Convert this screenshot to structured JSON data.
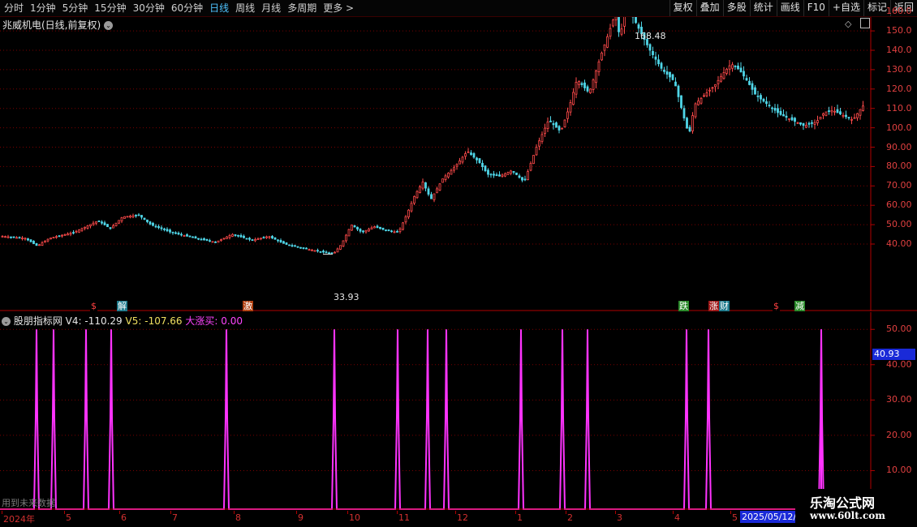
{
  "toolbar": {
    "periods": [
      "分时",
      "1分钟",
      "5分钟",
      "15分钟",
      "30分钟",
      "60分钟",
      "日线",
      "周线",
      "月线",
      "多周期",
      "更多 >"
    ],
    "active_period": "日线",
    "buttons": [
      "复权",
      "叠加",
      "多股",
      "统计",
      "画线",
      "F10",
      "+自选",
      "标记",
      "返回"
    ]
  },
  "main_chart": {
    "title": "兆威机电(日线,前复权)",
    "high_label": "168.48",
    "low_label": "33.93",
    "price_axis": [
      "160.0",
      "150.0",
      "140.0",
      "130.0",
      "120.0",
      "110.0",
      "100.0",
      "90.00",
      "80.00",
      "70.00",
      "60.00",
      "50.00",
      "40.00"
    ],
    "markers": [
      {
        "text": "$",
        "color": "#ff4040",
        "bg": "#000000"
      },
      {
        "text": "解",
        "color": "#ffffff",
        "bg": "#1e7a8c"
      },
      {
        "text": "激",
        "color": "#ffffff",
        "bg": "#b04010"
      },
      {
        "text": "跌",
        "color": "#ffffff",
        "bg": "#2a8a2a"
      },
      {
        "text": "涨",
        "color": "#ffffff",
        "bg": "#a01818"
      },
      {
        "text": "财",
        "color": "#ffffff",
        "bg": "#1e7a8c"
      },
      {
        "text": "$",
        "color": "#ff4040",
        "bg": "#000000"
      },
      {
        "text": "减",
        "color": "#ffffff",
        "bg": "#2a8a2a"
      }
    ]
  },
  "indicator": {
    "title": "股朋指标网",
    "v4_label": "V4: -110.29",
    "v5_label": "V5: -107.66",
    "buy_label": "大涨买: 0.00",
    "axis": [
      "50.00",
      "40.00",
      "30.00",
      "20.00",
      "10.00"
    ],
    "current_value": "40.93",
    "future_text": "用到未来数据"
  },
  "date_axis": {
    "labels": [
      "2024年",
      "5",
      "6",
      "7",
      "8",
      "9",
      "10",
      "11",
      "12",
      "1",
      "2",
      "3",
      "4",
      "5"
    ],
    "selected": "2025/05/12/"
  },
  "watermark": {
    "line1": "乐淘公式网",
    "line2": "www.60lt.com"
  },
  "colors": {
    "up": "#ff4a4a",
    "down": "#4fd6e8",
    "indicator": "#ff33ff",
    "grid": "#7a0000"
  }
}
